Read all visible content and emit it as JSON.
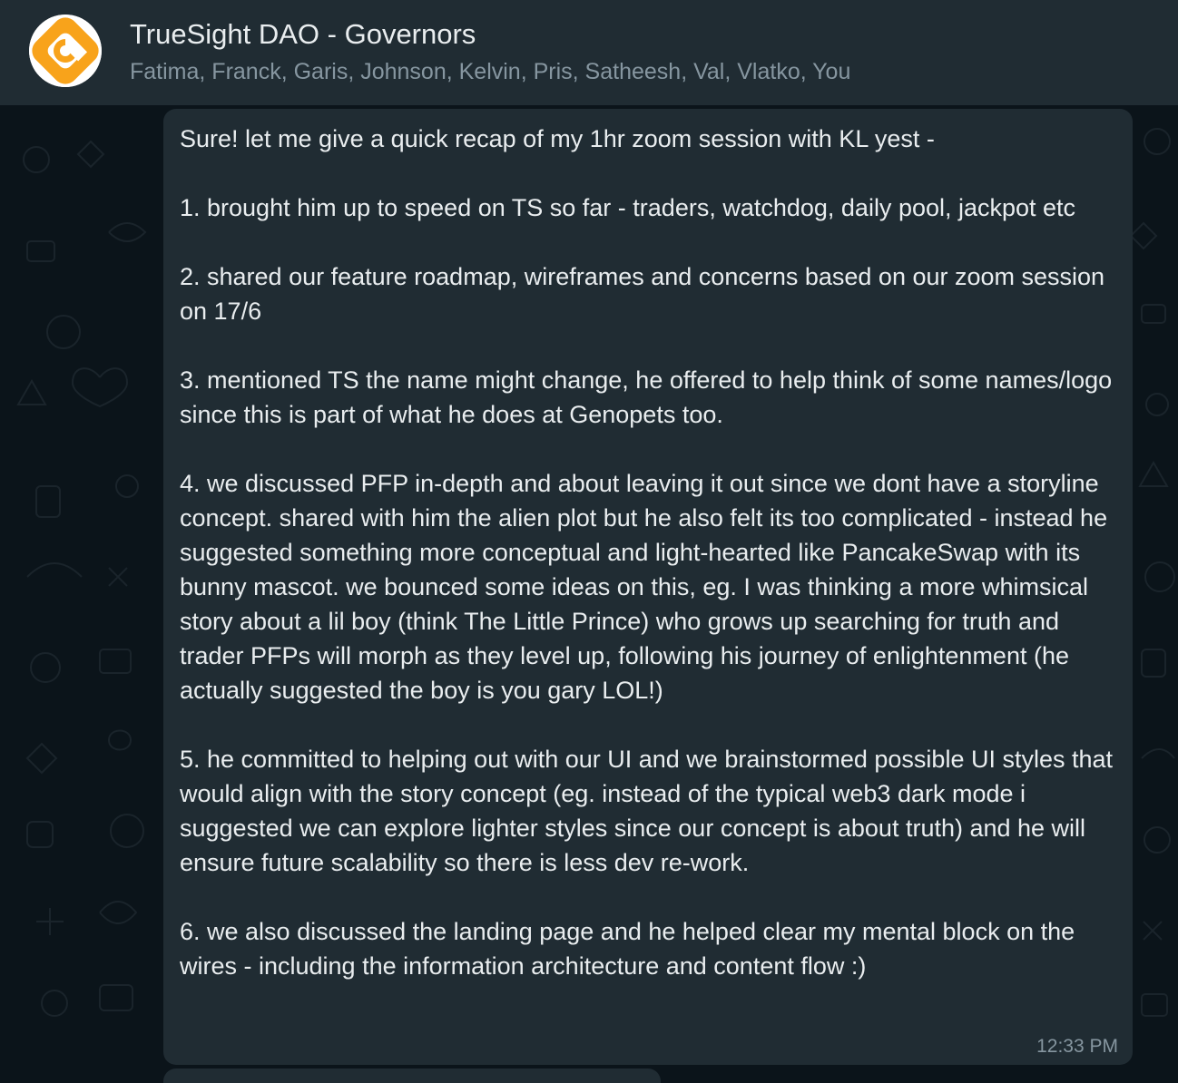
{
  "header": {
    "title": "TrueSight DAO - Governors",
    "members": "Fatima, Franck, Garis, Johnson, Kelvin, Pris, Satheesh, Val, Vlatko, You",
    "avatar_icon": "truesight-logo-icon",
    "avatar_color": "#f8a31b"
  },
  "message": {
    "text": "Sure! let me give a quick recap of my 1hr zoom session with KL yest -\n\n1. brought him up to speed on TS so far - traders, watchdog, daily pool, jackpot etc\n\n2. shared our feature roadmap, wireframes and concerns based on our zoom session on 17/6\n\n3. mentioned TS the name might change, he offered to help think of some names/logo since this is part of what he does at Genopets too.\n\n4. we discussed PFP in-depth and about leaving it out since we dont have a storyline concept. shared with him the alien plot but he also felt its too complicated - instead he suggested something more conceptual and light-hearted like PancakeSwap with its bunny mascot. we bounced some ideas on this, eg. I was thinking a more whimsical story about a lil boy (think The Little Prince) who grows up searching for truth and trader PFPs will morph as they level up, following his journey of enlightenment (he actually suggested the boy is you gary LOL!)\n\n5. he committed to helping out with our UI and we brainstormed possible UI styles that would align with the story concept (eg. instead of the typical web3 dark mode i suggested we can explore lighter styles since our concept is about truth) and he will ensure future scalability so there is less dev re-work.\n\n6. we also discussed the landing page and he helped clear my mental block on the wires - including the information architecture and content flow :)",
    "time": "12:33 PM"
  },
  "colors": {
    "header_bg": "#202c33",
    "chat_bg": "#0b141a",
    "bubble_bg": "#202c33",
    "text_primary": "#e9edef",
    "text_secondary": "#8696a0"
  }
}
